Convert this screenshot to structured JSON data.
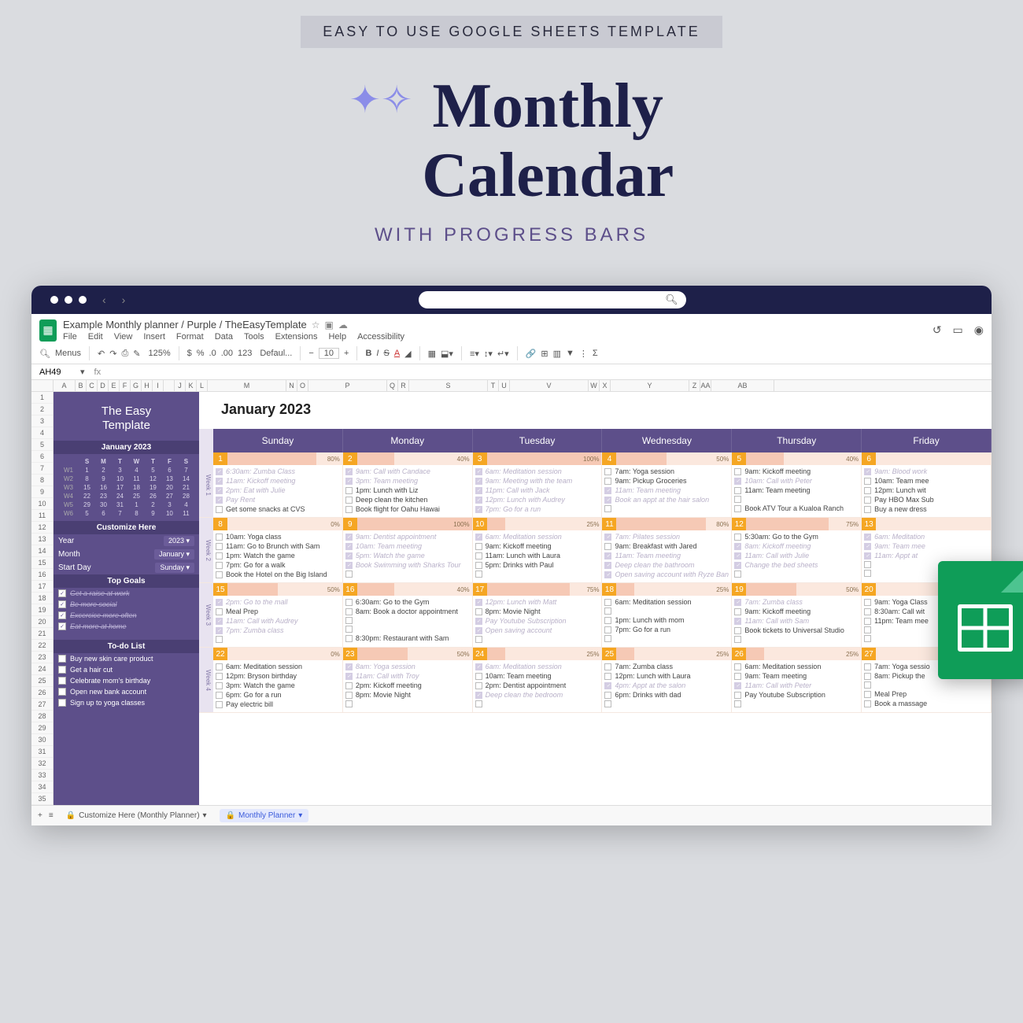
{
  "promo": {
    "tagline": "EASY TO USE GOOGLE SHEETS TEMPLATE",
    "title_line1": "Monthly",
    "title_line2": "Calendar",
    "subtitle": "WITH PROGRESS BARS"
  },
  "doc": {
    "title": "Example Monthly planner / Purple / TheEasyTemplate",
    "menus": [
      "File",
      "Edit",
      "View",
      "Insert",
      "Format",
      "Data",
      "Tools",
      "Extensions",
      "Help",
      "Accessibility"
    ],
    "cell_ref": "AH49",
    "zoom": "125%",
    "font": "Defaul...",
    "size": "10"
  },
  "cols": [
    "A",
    "B",
    "C",
    "D",
    "E",
    "F",
    "G",
    "H",
    "I",
    "",
    "J",
    "K",
    "L",
    "M",
    "N",
    "O",
    "P",
    "Q",
    "R",
    "S",
    "T",
    "U",
    "V",
    "W",
    "X",
    "Y",
    "Z",
    "AA",
    "AB"
  ],
  "rows_count": 35,
  "sidebar": {
    "brand1": "The Easy",
    "brand2": "Template",
    "cal_title": "January 2023",
    "dow": [
      "S",
      "M",
      "T",
      "W",
      "T",
      "F",
      "S"
    ],
    "weeks": [
      [
        "W1",
        "1",
        "2",
        "3",
        "4",
        "5",
        "6",
        "7"
      ],
      [
        "W2",
        "8",
        "9",
        "10",
        "11",
        "12",
        "13",
        "14"
      ],
      [
        "W3",
        "15",
        "16",
        "17",
        "18",
        "19",
        "20",
        "21"
      ],
      [
        "W4",
        "22",
        "23",
        "24",
        "25",
        "26",
        "27",
        "28"
      ],
      [
        "W5",
        "29",
        "30",
        "31",
        "1",
        "2",
        "3",
        "4"
      ],
      [
        "W6",
        "5",
        "6",
        "7",
        "8",
        "9",
        "10",
        "11"
      ]
    ],
    "customize_hdr": "Customize Here",
    "customize": [
      {
        "lbl": "Year",
        "val": "2023"
      },
      {
        "lbl": "Month",
        "val": "January"
      },
      {
        "lbl": "Start Day",
        "val": "Sunday"
      }
    ],
    "goals_hdr": "Top Goals",
    "goals": [
      {
        "txt": "Get a raise at work",
        "done": true
      },
      {
        "txt": "Be more social",
        "done": true
      },
      {
        "txt": "Excercice more often",
        "done": true
      },
      {
        "txt": "Eat more at home",
        "done": true
      }
    ],
    "todo_hdr": "To-do List",
    "todos": [
      {
        "txt": "Buy new skin care product"
      },
      {
        "txt": "Get a hair cut"
      },
      {
        "txt": "Celebrate mom's birthday"
      },
      {
        "txt": "Open new bank account"
      },
      {
        "txt": "Sign up to yoga classes"
      }
    ]
  },
  "calendar": {
    "month_title": "January 2023",
    "day_headers": [
      "Sunday",
      "Monday",
      "Tuesday",
      "Wednesday",
      "Thursday",
      "Friday"
    ],
    "weeks": [
      {
        "label": "Week 1",
        "days": [
          {
            "n": "1",
            "pct": "80%",
            "tasks": [
              {
                "t": "6:30am: Zumba Class",
                "d": true
              },
              {
                "t": "11am: Kickoff meeting",
                "d": true
              },
              {
                "t": "2pm: Eat with Julie",
                "d": true
              },
              {
                "t": "Pay Rent",
                "d": true
              },
              {
                "t": "Get some snacks at CVS",
                "d": false
              }
            ]
          },
          {
            "n": "2",
            "pct": "40%",
            "tasks": [
              {
                "t": "9am: Call with Candace",
                "d": true
              },
              {
                "t": "3pm: Team meeting",
                "d": true
              },
              {
                "t": "1pm: Lunch with Liz",
                "d": false
              },
              {
                "t": "Deep clean the kitchen",
                "d": false
              },
              {
                "t": "Book flight for Oahu Hawai",
                "d": false
              }
            ]
          },
          {
            "n": "3",
            "pct": "100%",
            "tasks": [
              {
                "t": "6am: Meditation session",
                "d": true
              },
              {
                "t": "9am: Meeting with the team",
                "d": true
              },
              {
                "t": "11pm: Call with Jack",
                "d": true
              },
              {
                "t": "12pm: Lunch with Audrey",
                "d": true
              },
              {
                "t": "7pm: Go for a run",
                "d": true
              }
            ]
          },
          {
            "n": "4",
            "pct": "50%",
            "tasks": [
              {
                "t": "7am: Yoga session",
                "d": false
              },
              {
                "t": "9am: Pickup Groceries",
                "d": false
              },
              {
                "t": "11am: Team meeting",
                "d": true
              },
              {
                "t": "Book an appt at the hair salon",
                "d": true
              },
              {
                "t": "",
                "d": false
              }
            ]
          },
          {
            "n": "5",
            "pct": "40%",
            "tasks": [
              {
                "t": "9am: Kickoff meeting",
                "d": false
              },
              {
                "t": "10am: Call with Peter",
                "d": true
              },
              {
                "t": "11am: Team meeting",
                "d": false
              },
              {
                "t": "",
                "d": false
              },
              {
                "t": "Book ATV Tour a Kualoa Ranch",
                "d": false
              }
            ]
          },
          {
            "n": "6",
            "pct": "",
            "tasks": [
              {
                "t": "9am: Blood work",
                "d": true
              },
              {
                "t": "10am: Team mee",
                "d": false
              },
              {
                "t": "12pm: Lunch wit",
                "d": false
              },
              {
                "t": "Pay HBO Max Sub",
                "d": false
              },
              {
                "t": "Buy a new dress",
                "d": false
              }
            ]
          }
        ]
      },
      {
        "label": "Week 2",
        "days": [
          {
            "n": "8",
            "pct": "0%",
            "tasks": [
              {
                "t": "10am: Yoga class",
                "d": false
              },
              {
                "t": "11am: Go to Brunch with Sam",
                "d": false
              },
              {
                "t": "1pm: Watch the game",
                "d": false
              },
              {
                "t": "7pm: Go for a walk",
                "d": false
              },
              {
                "t": "Book the Hotel on the Big Island",
                "d": false
              }
            ]
          },
          {
            "n": "9",
            "pct": "100%",
            "tasks": [
              {
                "t": "9am: Dentist appointment",
                "d": true
              },
              {
                "t": "10am: Team meeting",
                "d": true
              },
              {
                "t": "5pm: Watch the game",
                "d": true
              },
              {
                "t": "Book Swimming with Sharks Tour",
                "d": true
              },
              {
                "t": "",
                "d": false
              }
            ]
          },
          {
            "n": "10",
            "pct": "25%",
            "tasks": [
              {
                "t": "6am: Meditation session",
                "d": true
              },
              {
                "t": "9am: Kickoff meeting",
                "d": false
              },
              {
                "t": "11am: Lunch with Laura",
                "d": false
              },
              {
                "t": "5pm: Drinks with Paul",
                "d": false
              },
              {
                "t": "",
                "d": false
              }
            ]
          },
          {
            "n": "11",
            "pct": "80%",
            "tasks": [
              {
                "t": "7am: Pilates session",
                "d": true
              },
              {
                "t": "9am: Breakfast with Jared",
                "d": false
              },
              {
                "t": "11am: Team meeting",
                "d": true
              },
              {
                "t": "Deep clean the bathroom",
                "d": true
              },
              {
                "t": "Open saving account with Ryze Bank",
                "d": true
              }
            ]
          },
          {
            "n": "12",
            "pct": "75%",
            "tasks": [
              {
                "t": "5:30am: Go to the Gym",
                "d": false
              },
              {
                "t": "8am: Kickoff meeting",
                "d": true
              },
              {
                "t": "11am: Call with Julie",
                "d": true
              },
              {
                "t": "Change the bed sheets",
                "d": true
              },
              {
                "t": "",
                "d": false
              }
            ]
          },
          {
            "n": "13",
            "pct": "",
            "tasks": [
              {
                "t": "6am: Meditation",
                "d": true
              },
              {
                "t": "9am: Team mee",
                "d": true
              },
              {
                "t": "11am: Appt at",
                "d": true
              },
              {
                "t": "",
                "d": false
              },
              {
                "t": "",
                "d": false
              }
            ]
          }
        ]
      },
      {
        "label": "Week 3",
        "days": [
          {
            "n": "15",
            "pct": "50%",
            "tasks": [
              {
                "t": "2pm: Go to the mall",
                "d": true
              },
              {
                "t": "Meal Prep",
                "d": false
              },
              {
                "t": "11am: Call with Audrey",
                "d": true
              },
              {
                "t": "7pm: Zumba class",
                "d": true
              },
              {
                "t": "",
                "d": false
              }
            ]
          },
          {
            "n": "16",
            "pct": "40%",
            "tasks": [
              {
                "t": "6:30am: Go to the Gym",
                "d": false
              },
              {
                "t": "8am: Book a doctor appointment",
                "d": false
              },
              {
                "t": "",
                "d": false
              },
              {
                "t": "",
                "d": false
              },
              {
                "t": "8:30pm: Restaurant with Sam",
                "d": false
              }
            ]
          },
          {
            "n": "17",
            "pct": "75%",
            "tasks": [
              {
                "t": "12pm: Lunch with Matt",
                "d": true
              },
              {
                "t": "8pm: Movie Night",
                "d": false
              },
              {
                "t": "Pay Youtube Subscription",
                "d": true
              },
              {
                "t": "Open saving account",
                "d": true
              },
              {
                "t": "",
                "d": false
              }
            ]
          },
          {
            "n": "18",
            "pct": "25%",
            "tasks": [
              {
                "t": "6am: Meditation session",
                "d": false
              },
              {
                "t": "",
                "d": false
              },
              {
                "t": "1pm: Lunch with mom",
                "d": false
              },
              {
                "t": "7pm: Go for a run",
                "d": false
              },
              {
                "t": "",
                "d": false
              }
            ]
          },
          {
            "n": "19",
            "pct": "50%",
            "tasks": [
              {
                "t": "7am: Zumba class",
                "d": true
              },
              {
                "t": "9am: Kickoff meeting",
                "d": false
              },
              {
                "t": "11am: Call with Sam",
                "d": true
              },
              {
                "t": "Book tickets to Universal Studio",
                "d": false
              },
              {
                "t": "",
                "d": false
              }
            ]
          },
          {
            "n": "20",
            "pct": "",
            "tasks": [
              {
                "t": "9am: Yoga Class",
                "d": false
              },
              {
                "t": "8:30am: Call wit",
                "d": false
              },
              {
                "t": "11pm: Team mee",
                "d": false
              },
              {
                "t": "",
                "d": false
              },
              {
                "t": "",
                "d": false
              }
            ]
          }
        ]
      },
      {
        "label": "Week 4",
        "days": [
          {
            "n": "22",
            "pct": "0%",
            "tasks": [
              {
                "t": "6am: Meditation session",
                "d": false
              },
              {
                "t": "12pm: Bryson birthday",
                "d": false
              },
              {
                "t": "3pm: Watch the game",
                "d": false
              },
              {
                "t": "6pm: Go for a run",
                "d": false
              },
              {
                "t": "Pay electric bill",
                "d": false
              }
            ]
          },
          {
            "n": "23",
            "pct": "50%",
            "tasks": [
              {
                "t": "8am: Yoga session",
                "d": true
              },
              {
                "t": "11am: Call with Troy",
                "d": true
              },
              {
                "t": "2pm: Kickoff meeting",
                "d": false
              },
              {
                "t": "8pm: Movie Night",
                "d": false
              },
              {
                "t": "",
                "d": false
              }
            ]
          },
          {
            "n": "24",
            "pct": "25%",
            "tasks": [
              {
                "t": "6am: Meditation session",
                "d": true
              },
              {
                "t": "10am: Team meeting",
                "d": false
              },
              {
                "t": "2pm: Dentist appointment",
                "d": false
              },
              {
                "t": "Deep clean the bedroom",
                "d": true
              },
              {
                "t": "",
                "d": false
              }
            ]
          },
          {
            "n": "25",
            "pct": "25%",
            "tasks": [
              {
                "t": "7am: Zumba class",
                "d": false
              },
              {
                "t": "12pm: Lunch with Laura",
                "d": false
              },
              {
                "t": "4pm: Appt at the salon",
                "d": true
              },
              {
                "t": "6pm: Drinks with dad",
                "d": false
              },
              {
                "t": "",
                "d": false
              }
            ]
          },
          {
            "n": "26",
            "pct": "25%",
            "tasks": [
              {
                "t": "6am: Meditation session",
                "d": false
              },
              {
                "t": "9am: Team meeting",
                "d": false
              },
              {
                "t": "11am: Call with Peter",
                "d": true
              },
              {
                "t": "Pay Youtube Subscription",
                "d": false
              },
              {
                "t": "",
                "d": false
              }
            ]
          },
          {
            "n": "27",
            "pct": "",
            "tasks": [
              {
                "t": "7am: Yoga sessio",
                "d": false
              },
              {
                "t": "8am: Pickup the",
                "d": false
              },
              {
                "t": "",
                "d": false
              },
              {
                "t": "Meal Prep",
                "d": false
              },
              {
                "t": "Book a massage",
                "d": false
              }
            ]
          }
        ]
      }
    ]
  },
  "tabs": {
    "t1": "Customize Here (Monthly Planner)",
    "t2": "Monthly Planner"
  }
}
